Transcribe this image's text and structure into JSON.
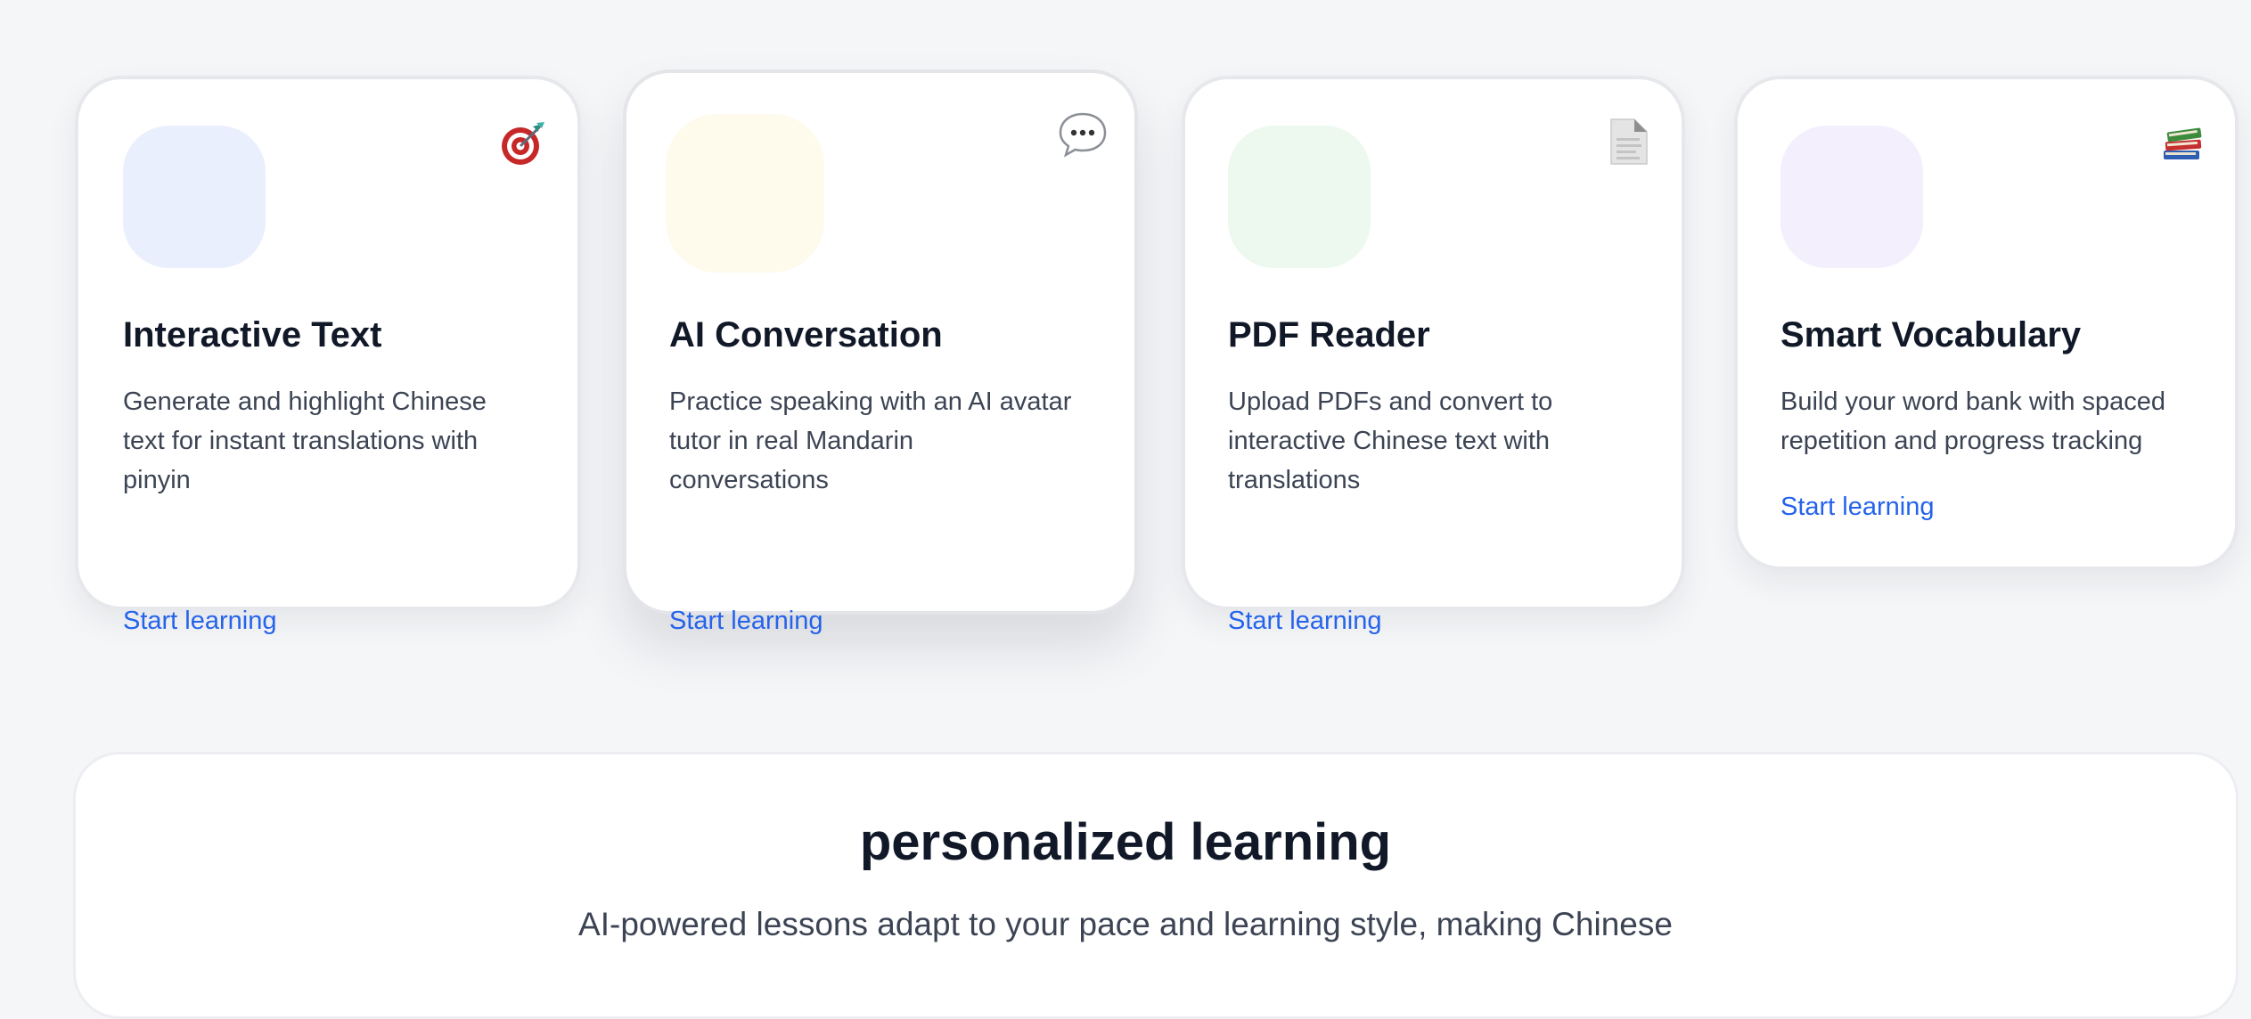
{
  "features": [
    {
      "title": "Interactive Text",
      "description": "Generate and highlight Chinese text for instant translations with pinyin",
      "link": "Start learning",
      "icon": "target-icon",
      "tile_color": "#eaeffd"
    },
    {
      "title": "AI Conversation",
      "description": "Practice speaking with an AI avatar tutor in real Mandarin conversations",
      "link": "Start learning",
      "icon": "speech-bubble-icon",
      "tile_color": "#fefaec"
    },
    {
      "title": "PDF Reader",
      "description": "Upload PDFs and convert to interactive Chinese text with translations",
      "link": "Start learning",
      "icon": "document-icon",
      "tile_color": "#edf8ee"
    },
    {
      "title": "Smart Vocabulary",
      "description": "Build your word bank with spaced repetition and progress tracking",
      "link": "Start learning",
      "icon": "books-icon",
      "tile_color": "#f3effc"
    }
  ],
  "section": {
    "title": "personalized learning",
    "subtitle": "AI-powered lessons adapt to your pace and learning style, making Chinese"
  },
  "colors": {
    "link": "#2563eb",
    "title": "#111827",
    "body_text": "#3c4454",
    "background": "#f5f6f8"
  }
}
